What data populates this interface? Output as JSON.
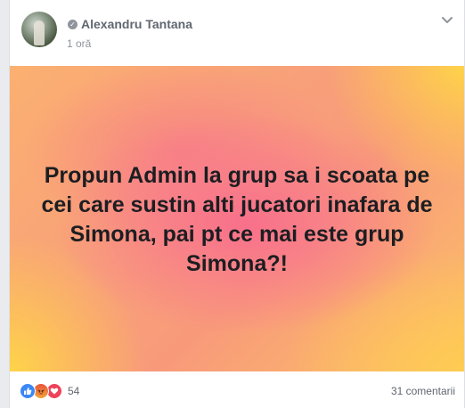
{
  "post": {
    "author": "Alexandru Tantana",
    "time": "1 oră",
    "text": "Propun Admin la grup sa i scoata pe cei care sustin alti jucatori inafara de Simona, pai pt ce mai este grup Simona?!"
  },
  "footer": {
    "reaction_count": "54",
    "comments": "31 comentarii",
    "reactions": [
      "like-icon",
      "angry-icon",
      "love-icon"
    ]
  },
  "colors": {
    "text_dark": "#1c1e21",
    "meta_gray": "#90949c",
    "like_blue": "#3b88f6",
    "love_red": "#f0435b",
    "gradient_pink": "#f86e8c",
    "gradient_yellow": "#ffd646"
  }
}
